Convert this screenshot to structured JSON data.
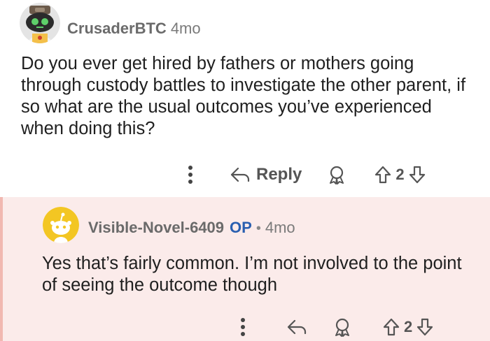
{
  "comments": [
    {
      "username": "CrusaderBTC",
      "age": "4mo",
      "body": "Do you ever get hired by fathers or mothers going through custody battles to investigate the other parent, if so what are the usual outcomes you’ve experienced when doing this?",
      "reply_label": "Reply",
      "vote_count": "2",
      "avatar_icon": "robot-snoo-avatar-icon"
    },
    {
      "username": "Visible-Novel-6409",
      "op_badge": "OP",
      "separator": "•",
      "age": "4mo",
      "body": "Yes that’s fairly common. I’m not involved to the point of seeing the outcome though",
      "vote_count": "2",
      "avatar_icon": "default-snoo-avatar-icon"
    }
  ],
  "colors": {
    "reply_background": "#fbebea",
    "thread_line": "#f1b8b1",
    "op_badge": "#2a5fb0",
    "username": "#6b6b6b"
  }
}
